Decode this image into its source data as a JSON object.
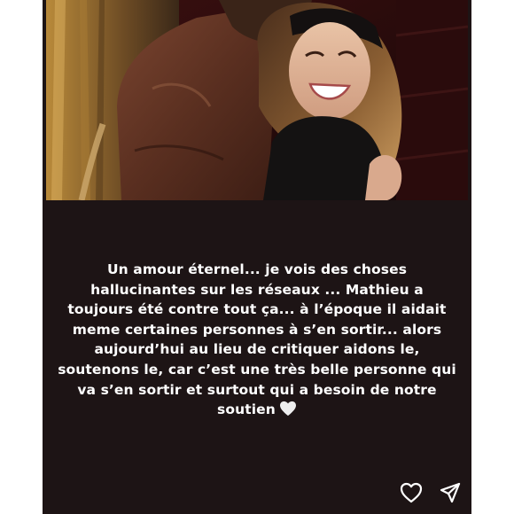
{
  "story": {
    "caption_lines": [
      "Un amour éternel... je vois des choses",
      "hallucinantes sur les réseaux ... Mathieu a",
      "toujours été contre tout ça... à l’époque il aidait",
      "meme certaines personnes à s’en sortir... alors",
      "aujourd’hui au lieu de critiquer aidons le,",
      "soutenons le, car c’est une très belle personne qui",
      "va s’en sortir et surtout qui a besoin de notre",
      "soutien"
    ],
    "caption_emoji": "white-heart-emoji"
  },
  "actions": {
    "like_icon": "heart-outline-icon",
    "share_icon": "paper-plane-icon"
  },
  "colors": {
    "background": "#1d1415",
    "text": "#ffffff",
    "page": "#ffffff"
  }
}
